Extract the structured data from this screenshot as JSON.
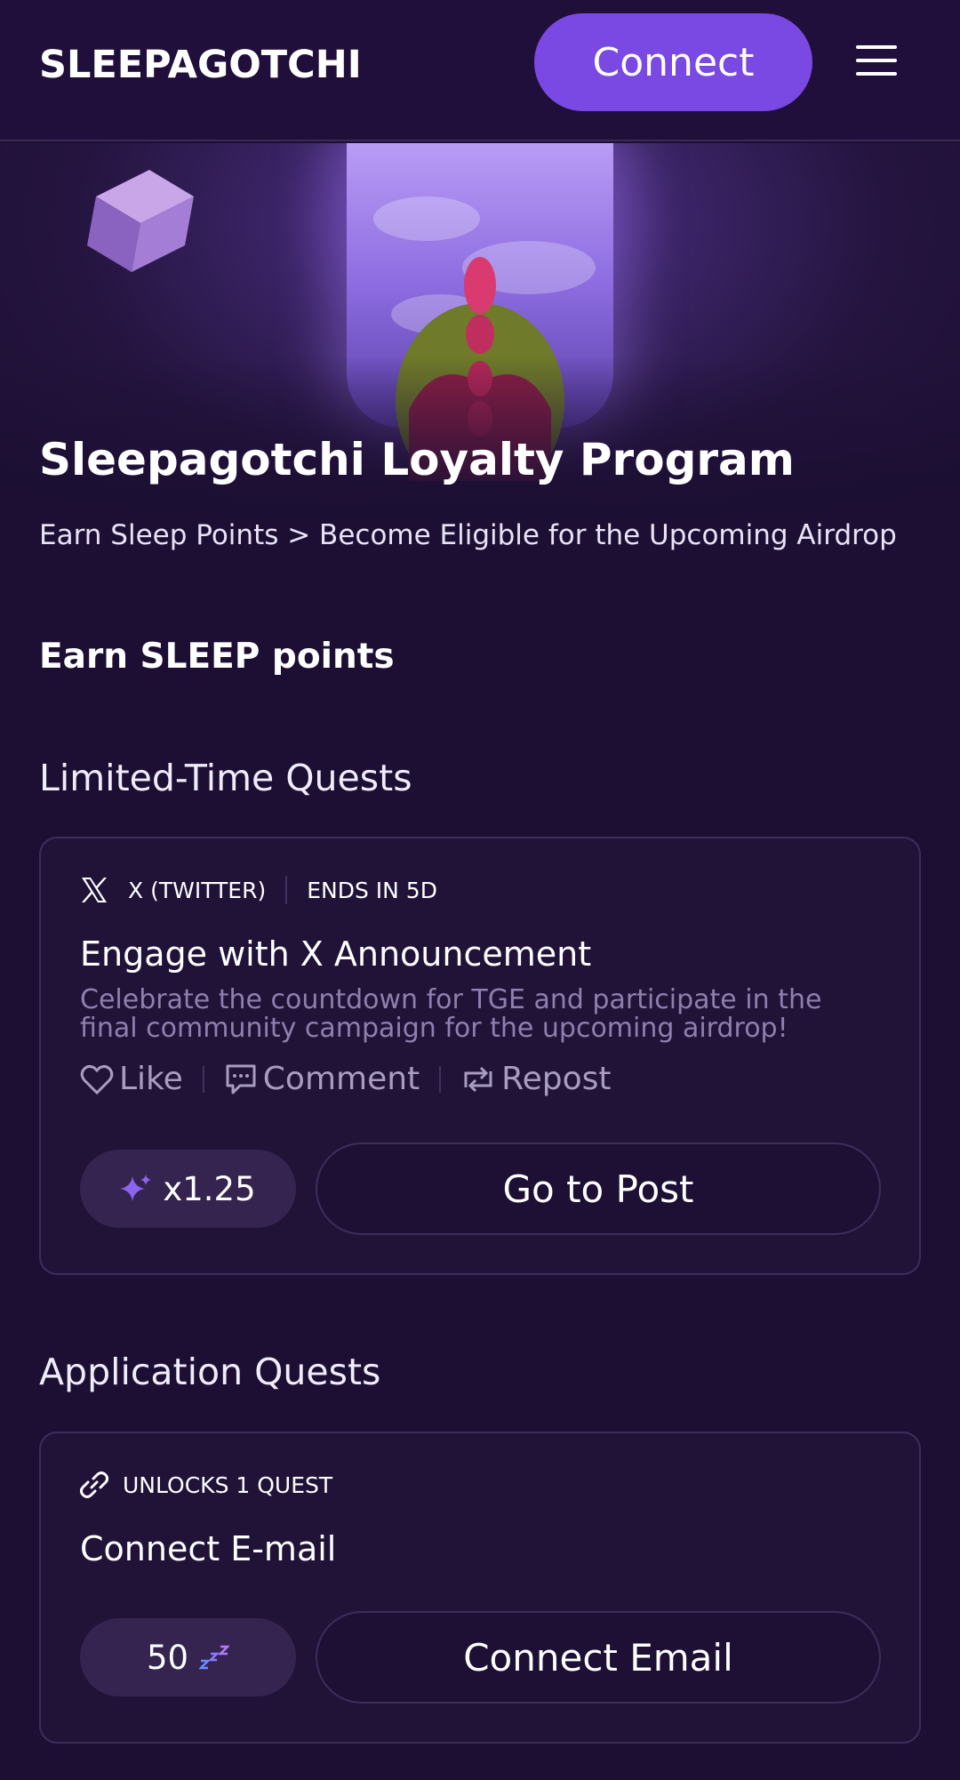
{
  "header": {
    "logo_text": "SLEEPAGOTCHI",
    "connect_label": "Connect",
    "menu_icon": "hamburger-menu-icon"
  },
  "hero": {
    "title": "Sleepagotchi Loyalty Program",
    "subtitle": "Earn Sleep Points > Become Eligible for the Upcoming Airdrop"
  },
  "main": {
    "section_title": "Earn SLEEP points",
    "limited_quests": {
      "heading": "Limited-Time Quests",
      "quest": {
        "platform_icon": "x-logo-icon",
        "platform": "X (TWITTER)",
        "ends": "ENDS IN 5D",
        "title": "Engage with X Announcement",
        "description": "Celebrate the countdown for TGE and participate in the final community campaign for the upcoming airdrop!",
        "actions": [
          {
            "icon": "heart-icon",
            "label": "Like"
          },
          {
            "icon": "comment-icon",
            "label": "Comment"
          },
          {
            "icon": "repost-icon",
            "label": "Repost"
          }
        ],
        "multiplier_icon": "sparkle-icon",
        "multiplier": "x1.25",
        "button_label": "Go to Post"
      }
    },
    "application_quests": {
      "heading": "Application Quests",
      "quest": {
        "badge_icon": "link-icon",
        "badge": "UNLOCKS 1 QUEST",
        "title": "Connect E-mail",
        "points": "50",
        "points_icon": "zzz-icon",
        "button_label": "Connect Email"
      }
    }
  },
  "colors": {
    "background": "#1c0f33",
    "accent": "#7a49e3",
    "card_border": "#3c2d5c",
    "muted_text": "#8e7fae"
  }
}
